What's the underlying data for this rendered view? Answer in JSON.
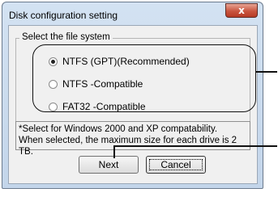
{
  "window": {
    "title": "Disk configuration setting",
    "close_glyph": "x"
  },
  "group": {
    "legend": "Select the file system",
    "options": [
      {
        "label": "NTFS (GPT)(Recommended)",
        "checked": true
      },
      {
        "label": "NTFS -Compatible",
        "checked": false
      },
      {
        "label": "FAT32 -Compatible",
        "checked": false
      }
    ]
  },
  "note": {
    "line1": "*Select for Windows 2000 and XP compatability.",
    "line2": "When selected, the maximum size for each drive is 2 TB."
  },
  "buttons": {
    "next": "Next",
    "cancel": "Cancel"
  }
}
